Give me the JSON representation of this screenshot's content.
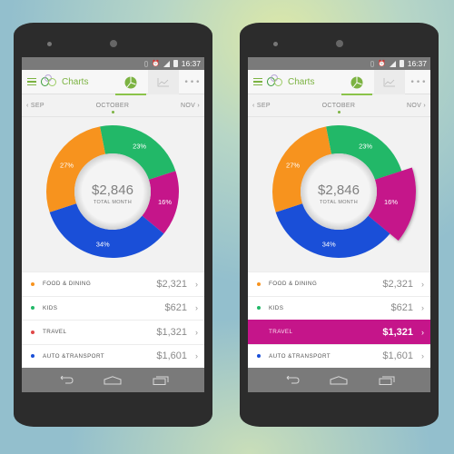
{
  "phones": [
    {
      "id": "left",
      "status_bar": {
        "time": "16:37"
      },
      "app_bar": {
        "title": "Charts",
        "more_label": "•••"
      },
      "month_nav": {
        "prev": "‹ SEP",
        "current": "OCTOBER",
        "next": "NOV ›"
      },
      "center": {
        "amount": "$2,846",
        "caption": "TOTAL MONTH"
      },
      "exploded_segment": null,
      "categories": [
        {
          "label": "FOOD & DINING",
          "amount": "$2,321",
          "color": "#f7931e",
          "selected": false
        },
        {
          "label": "KIDS",
          "amount": "$621",
          "color": "#22b868",
          "selected": false
        },
        {
          "label": "TRAVEL",
          "amount": "$1,321",
          "color": "#e04848",
          "selected": false
        },
        {
          "label": "AUTO &TRANSPORT",
          "amount": "$1,601",
          "color": "#1a4fd8",
          "selected": false
        }
      ]
    },
    {
      "id": "right",
      "status_bar": {
        "time": "16:37"
      },
      "app_bar": {
        "title": "Charts",
        "more_label": "•••"
      },
      "month_nav": {
        "prev": "‹ SEP",
        "current": "OCTOBER",
        "next": "NOV ›"
      },
      "center": {
        "amount": "$2,846",
        "caption": "TOTAL MONTH"
      },
      "exploded_segment": "16%",
      "categories": [
        {
          "label": "FOOD & DINING",
          "amount": "$2,321",
          "color": "#f7931e",
          "selected": false
        },
        {
          "label": "KIDS",
          "amount": "$621",
          "color": "#22b868",
          "selected": false
        },
        {
          "label": "TRAVEL",
          "amount": "$1,321",
          "color": "#c5158a",
          "selected": true
        },
        {
          "label": "AUTO &TRANSPORT",
          "amount": "$1,601",
          "color": "#1a4fd8",
          "selected": false
        }
      ]
    }
  ],
  "chart_data": {
    "type": "pie",
    "subtype": "donut",
    "title": "",
    "center_label": "$2,846",
    "center_caption": "TOTAL MONTH",
    "slices": [
      {
        "label": "23%",
        "value": 23,
        "color": "#22b868"
      },
      {
        "label": "16%",
        "value": 16,
        "color": "#c5158a"
      },
      {
        "label": "34%",
        "value": 34,
        "color": "#1a4fd8"
      },
      {
        "label": "27%",
        "value": 27,
        "color": "#f7931e"
      }
    ]
  },
  "colors": {
    "accent": "#7cb342",
    "selected_row": "#c5158a",
    "status_bar": "#7a7a7a",
    "phone_body": "#2c2c2c"
  }
}
